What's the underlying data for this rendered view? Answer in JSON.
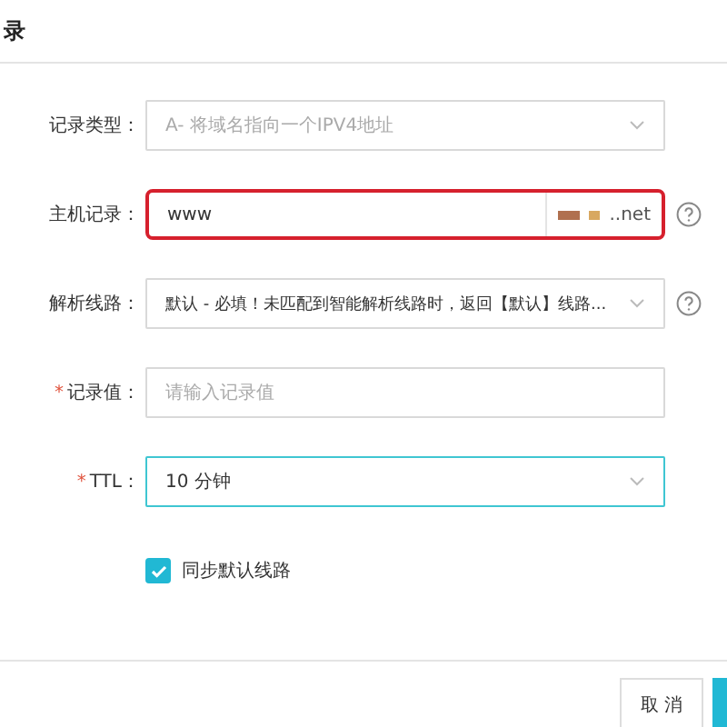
{
  "dialog": {
    "title": "录"
  },
  "fields": [
    {
      "label": "记录类型：",
      "kind": "select",
      "error": false,
      "focused": false,
      "disabled": true,
      "value": "A- 将域名指向一个IPV4地址",
      "help": false
    },
    {
      "label": "主机记录：",
      "kind": "input",
      "error": true,
      "focused": false,
      "value": "www",
      "suffix": "..net",
      "help": true
    },
    {
      "label": "解析线路：",
      "kind": "select",
      "error": false,
      "focused": false,
      "disabled": false,
      "value": "默认 - 必填！未匹配到智能解析线路时，返回【默认】线路...",
      "help": true
    },
    {
      "required_mark": "*",
      "label": "记录值：",
      "kind": "input",
      "error": false,
      "focused": false,
      "placeholder": "请输入记录值",
      "help": false
    },
    {
      "required_mark": "*",
      "label": "TTL：",
      "kind": "select",
      "error": false,
      "focused": true,
      "disabled": false,
      "value": "10 分钟",
      "help": false
    }
  ],
  "sync": {
    "label": "同步默认线路",
    "checked": true
  },
  "buttons": [
    {
      "label": "取 消",
      "kind": "secondary"
    },
    {
      "kind": "primary"
    }
  ]
}
